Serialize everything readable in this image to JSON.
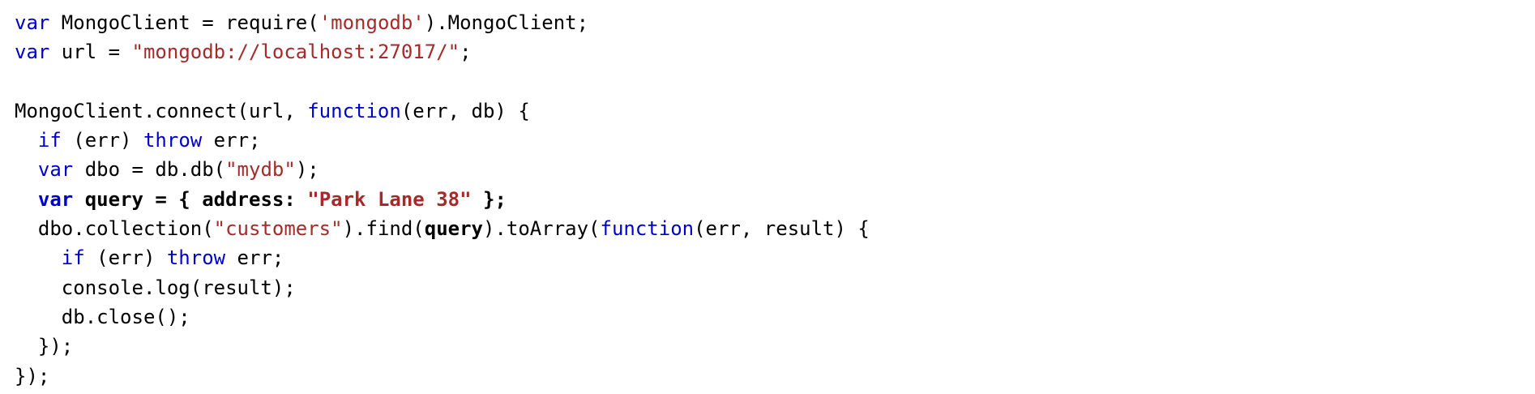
{
  "code": {
    "lines": [
      {
        "tokens": [
          {
            "t": "var",
            "k": "kw"
          },
          {
            "t": " MongoClient = require(",
            "k": "plain"
          },
          {
            "t": "'mongodb'",
            "k": "str"
          },
          {
            "t": ").MongoClient;",
            "k": "plain"
          }
        ]
      },
      {
        "tokens": [
          {
            "t": "var",
            "k": "kw"
          },
          {
            "t": " url = ",
            "k": "plain"
          },
          {
            "t": "\"mongodb://localhost:27017/\"",
            "k": "str"
          },
          {
            "t": ";",
            "k": "plain"
          }
        ]
      },
      {
        "tokens": []
      },
      {
        "tokens": [
          {
            "t": "MongoClient.connect(url, ",
            "k": "plain"
          },
          {
            "t": "function",
            "k": "kw"
          },
          {
            "t": "(err, db) {",
            "k": "plain"
          }
        ]
      },
      {
        "tokens": [
          {
            "t": "  ",
            "k": "plain"
          },
          {
            "t": "if",
            "k": "kw"
          },
          {
            "t": " (err) ",
            "k": "plain"
          },
          {
            "t": "throw",
            "k": "kw"
          },
          {
            "t": " err;",
            "k": "plain"
          }
        ]
      },
      {
        "tokens": [
          {
            "t": "  ",
            "k": "plain"
          },
          {
            "t": "var",
            "k": "kw"
          },
          {
            "t": " dbo = db.db(",
            "k": "plain"
          },
          {
            "t": "\"mydb\"",
            "k": "str"
          },
          {
            "t": ");",
            "k": "plain"
          }
        ]
      },
      {
        "tokens": [
          {
            "t": "  ",
            "k": "plain"
          },
          {
            "t": "var",
            "k": "kw",
            "b": true
          },
          {
            "t": " query = { address: ",
            "k": "plain",
            "b": true
          },
          {
            "t": "\"Park Lane 38\"",
            "k": "str",
            "b": true
          },
          {
            "t": " };",
            "k": "plain",
            "b": true
          }
        ]
      },
      {
        "tokens": [
          {
            "t": "  dbo.collection(",
            "k": "plain"
          },
          {
            "t": "\"customers\"",
            "k": "str"
          },
          {
            "t": ").find(",
            "k": "plain"
          },
          {
            "t": "query",
            "k": "plain",
            "b": true
          },
          {
            "t": ").toArray(",
            "k": "plain"
          },
          {
            "t": "function",
            "k": "kw"
          },
          {
            "t": "(err, result) {",
            "k": "plain"
          }
        ]
      },
      {
        "tokens": [
          {
            "t": "    ",
            "k": "plain"
          },
          {
            "t": "if",
            "k": "kw"
          },
          {
            "t": " (err) ",
            "k": "plain"
          },
          {
            "t": "throw",
            "k": "kw"
          },
          {
            "t": " err;",
            "k": "plain"
          }
        ]
      },
      {
        "tokens": [
          {
            "t": "    console.log(result);",
            "k": "plain"
          }
        ]
      },
      {
        "tokens": [
          {
            "t": "    db.close();",
            "k": "plain"
          }
        ]
      },
      {
        "tokens": [
          {
            "t": "  });",
            "k": "plain"
          }
        ]
      },
      {
        "tokens": [
          {
            "t": "});",
            "k": "plain"
          }
        ]
      }
    ]
  }
}
